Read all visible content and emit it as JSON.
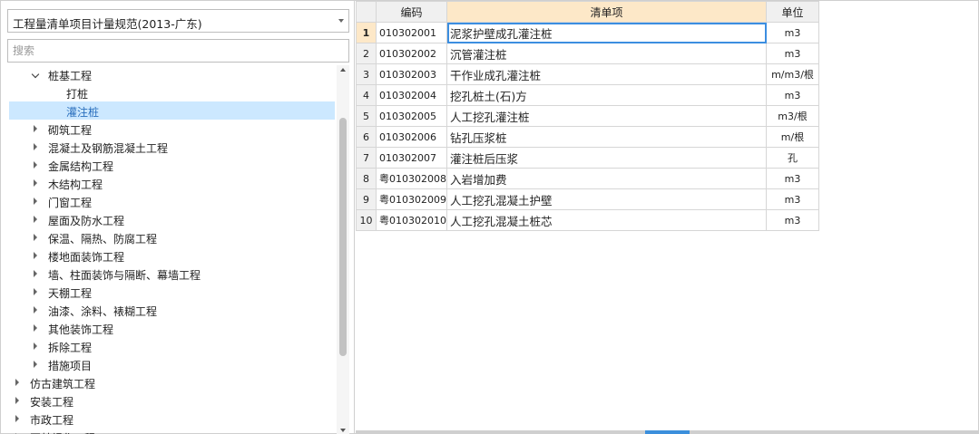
{
  "spec_select": {
    "value": "工程量清单项目计量规范(2013-广东)"
  },
  "search": {
    "placeholder": "搜索"
  },
  "tree": [
    {
      "label": "桩基工程",
      "level": 1,
      "state": "expanded"
    },
    {
      "label": "打桩",
      "level": 2,
      "state": "leaf"
    },
    {
      "label": "灌注桩",
      "level": 2,
      "state": "leaf",
      "selected": true
    },
    {
      "label": "砌筑工程",
      "level": 1,
      "state": "collapsed"
    },
    {
      "label": "混凝土及钢筋混凝土工程",
      "level": 1,
      "state": "collapsed"
    },
    {
      "label": "金属结构工程",
      "level": 1,
      "state": "collapsed"
    },
    {
      "label": "木结构工程",
      "level": 1,
      "state": "collapsed"
    },
    {
      "label": "门窗工程",
      "level": 1,
      "state": "collapsed"
    },
    {
      "label": "屋面及防水工程",
      "level": 1,
      "state": "collapsed"
    },
    {
      "label": "保温、隔热、防腐工程",
      "level": 1,
      "state": "collapsed"
    },
    {
      "label": "楼地面装饰工程",
      "level": 1,
      "state": "collapsed"
    },
    {
      "label": "墙、柱面装饰与隔断、幕墙工程",
      "level": 1,
      "state": "collapsed"
    },
    {
      "label": "天棚工程",
      "level": 1,
      "state": "collapsed"
    },
    {
      "label": "油漆、涂料、裱糊工程",
      "level": 1,
      "state": "collapsed"
    },
    {
      "label": "其他装饰工程",
      "level": 1,
      "state": "collapsed"
    },
    {
      "label": "拆除工程",
      "level": 1,
      "state": "collapsed"
    },
    {
      "label": "措施项目",
      "level": 1,
      "state": "collapsed"
    },
    {
      "label": "仿古建筑工程",
      "level": 0,
      "state": "collapsed"
    },
    {
      "label": "安装工程",
      "level": 0,
      "state": "collapsed"
    },
    {
      "label": "市政工程",
      "level": 0,
      "state": "collapsed"
    },
    {
      "label": "园林绿化工程",
      "level": 0,
      "state": "collapsed"
    }
  ],
  "table": {
    "headers": {
      "code": "编码",
      "name": "清单项",
      "unit": "单位"
    },
    "rows": [
      {
        "no": "1",
        "code": "010302001",
        "name": "泥浆护壁成孔灌注桩",
        "unit": "m3"
      },
      {
        "no": "2",
        "code": "010302002",
        "name": "沉管灌注桩",
        "unit": "m3"
      },
      {
        "no": "3",
        "code": "010302003",
        "name": "干作业成孔灌注桩",
        "unit": "m/m3/根"
      },
      {
        "no": "4",
        "code": "010302004",
        "name": "挖孔桩土(石)方",
        "unit": "m3"
      },
      {
        "no": "5",
        "code": "010302005",
        "name": "人工挖孔灌注桩",
        "unit": "m3/根"
      },
      {
        "no": "6",
        "code": "010302006",
        "name": "钻孔压浆桩",
        "unit": "m/根"
      },
      {
        "no": "7",
        "code": "010302007",
        "name": "灌注桩后压浆",
        "unit": "孔"
      },
      {
        "no": "8",
        "code": "粤010302008",
        "name": "入岩增加费",
        "unit": "m3"
      },
      {
        "no": "9",
        "code": "粤010302009",
        "name": "人工挖孔混凝土护壁",
        "unit": "m3"
      },
      {
        "no": "10",
        "code": "粤010302010",
        "name": "人工挖孔混凝土桩芯",
        "unit": "m3"
      }
    ]
  },
  "colors": {
    "selection": "#cce8ff",
    "header_active": "#fde8c8",
    "focus": "#3c8ee0",
    "grip": "#3b8fdc"
  }
}
